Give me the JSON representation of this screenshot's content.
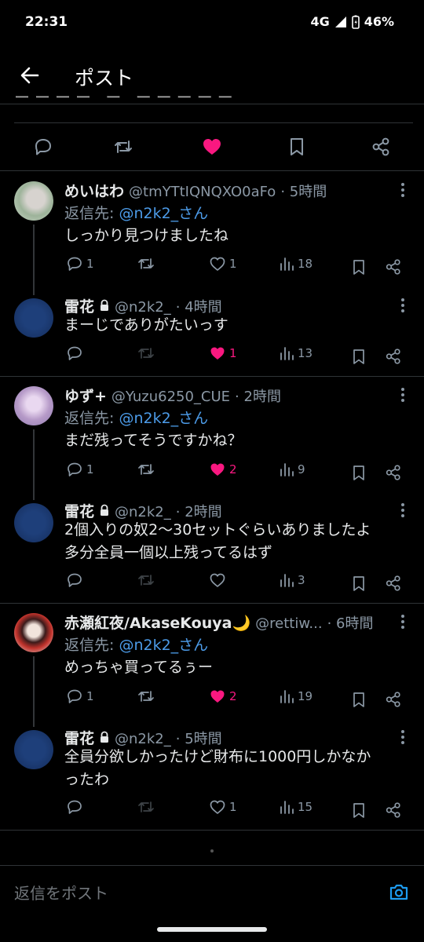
{
  "status_bar": {
    "time": "22:31",
    "network": "4G",
    "battery": "46%"
  },
  "header": {
    "title": "ポスト"
  },
  "colors": {
    "accent": "#1d9bf0",
    "like": "#f91880",
    "mention": "#4c9be8",
    "muted": "#8b98a5"
  },
  "posts": [
    {
      "name": "めいはわ",
      "handle": "@tmYTtIQNQXO0aFo",
      "time": "· 5時間",
      "reply_label": "返信先: ",
      "reply_mention": "@n2k2_さん",
      "text": "しっかり見つけましたね",
      "replies": "1",
      "likes": "1",
      "views": "18",
      "liked": false,
      "locked": false
    },
    {
      "name": "雷花",
      "handle": "@n2k2_",
      "time": "· 4時間",
      "text": "まーじでありがたいっす",
      "replies": "",
      "likes": "1",
      "views": "13",
      "liked": true,
      "locked": true
    },
    {
      "name": "ゆず+",
      "handle": "@Yuzu6250_CUE",
      "time": "· 2時間",
      "reply_label": "返信先: ",
      "reply_mention": "@n2k2_さん",
      "text": "まだ残ってそうですかね？",
      "replies": "1",
      "likes": "2",
      "views": "9",
      "liked": true,
      "locked": false
    },
    {
      "name": "雷花",
      "handle": "@n2k2_",
      "time": "· 2時間",
      "text_line1": "2個入りの奴2〜30セットぐらいありましたよ",
      "text_line2": "多分全員一個以上残ってるはず",
      "replies": "",
      "likes": "",
      "views": "3",
      "liked": false,
      "locked": true
    },
    {
      "name": "赤瀬紅夜/AkaseKouya🌙",
      "handle": "@rettiw...",
      "time": "· 6時間",
      "reply_label": "返信先: ",
      "reply_mention": "@n2k2_さん",
      "text": "めっちゃ買ってるぅー",
      "replies": "1",
      "likes": "2",
      "views": "19",
      "liked": true,
      "locked": false
    },
    {
      "name": "雷花",
      "handle": "@n2k2_",
      "time": "· 5時間",
      "text_line1": "全員分欲しかったけど財布に1000円しかなか",
      "text_line2": "ったわ",
      "replies": "",
      "likes": "1",
      "views": "15",
      "liked": false,
      "locked": true
    }
  ],
  "composer": {
    "placeholder": "返信をポスト"
  }
}
